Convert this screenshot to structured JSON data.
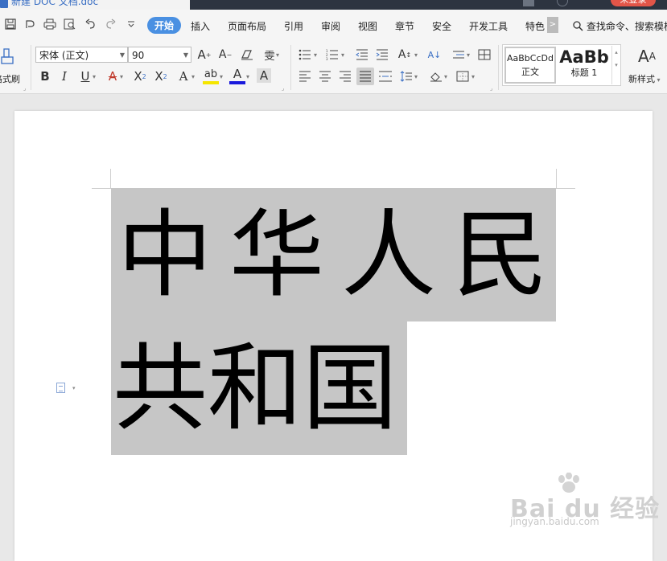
{
  "window": {
    "doc_title": "新建 DOC 文档.doc",
    "login_button": "未登录"
  },
  "menu": {
    "tabs": [
      "开始",
      "插入",
      "页面布局",
      "引用",
      "审阅",
      "视图",
      "章节",
      "安全",
      "开发工具",
      "特色"
    ],
    "more": ">",
    "search": "查找命令、搜索模板"
  },
  "ribbon": {
    "format_painter": "格式刷",
    "font_name": "宋体 (正文)",
    "font_size": "90",
    "styles": [
      {
        "sample": "AaBbCcDd",
        "name": "正文"
      },
      {
        "sample": "AaBb",
        "name": "标题 1"
      }
    ],
    "new_style": "新样式"
  },
  "document": {
    "line1": "中华人民",
    "line2": "共和国"
  },
  "watermark": {
    "main": "Bai du 经验",
    "url": "jingyan.baidu.com"
  },
  "colors": {
    "accent": "#4a90e2",
    "highlight": "#f5e600",
    "font_color": "#1a1adc",
    "selection": "#c6c6c6"
  }
}
